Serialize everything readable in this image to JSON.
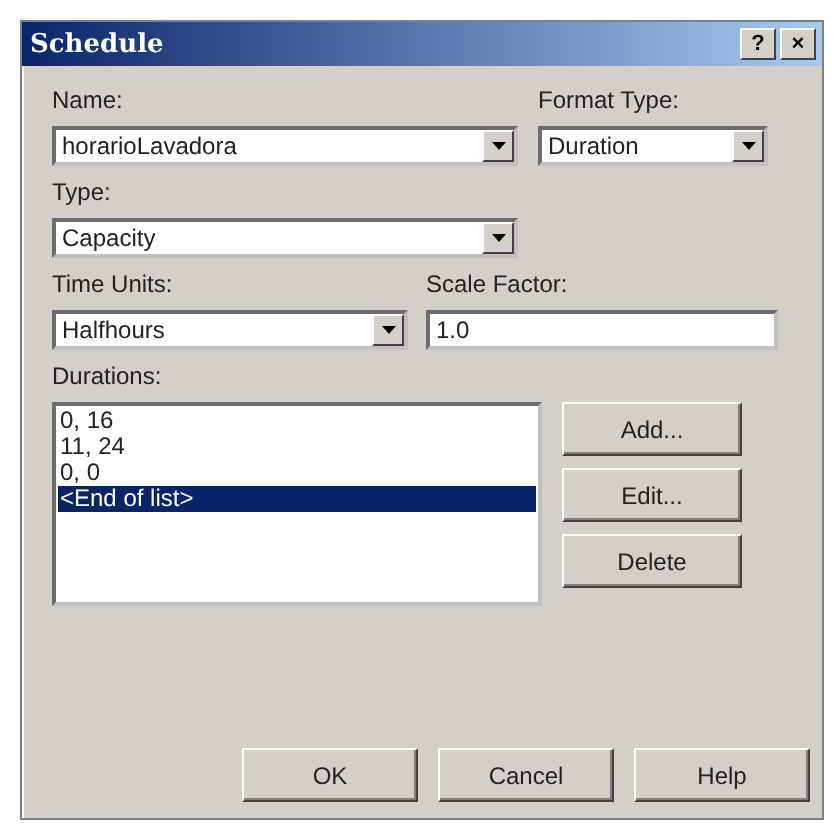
{
  "window": {
    "title": "Schedule",
    "title_buttons": [
      "?",
      "×"
    ]
  },
  "name": {
    "label": "Name:",
    "value": "horarioLavadora"
  },
  "format_type": {
    "label": "Format Type:",
    "value": "Duration"
  },
  "type": {
    "label": "Type:",
    "value": "Capacity"
  },
  "time_units": {
    "label": "Time Units:",
    "value": "Halfhours"
  },
  "scale_factor": {
    "label": "Scale Factor:",
    "value": "1.0"
  },
  "durations": {
    "label": "Durations:",
    "items": [
      {
        "text": "0, 16",
        "selected": false
      },
      {
        "text": "11, 24",
        "selected": false
      },
      {
        "text": "0, 0",
        "selected": false
      },
      {
        "text": "<End of list>",
        "selected": true
      }
    ]
  },
  "list_buttons": [
    "Add...",
    "Edit...",
    "Delete"
  ],
  "buttons": [
    "OK",
    "Cancel",
    "Help"
  ]
}
